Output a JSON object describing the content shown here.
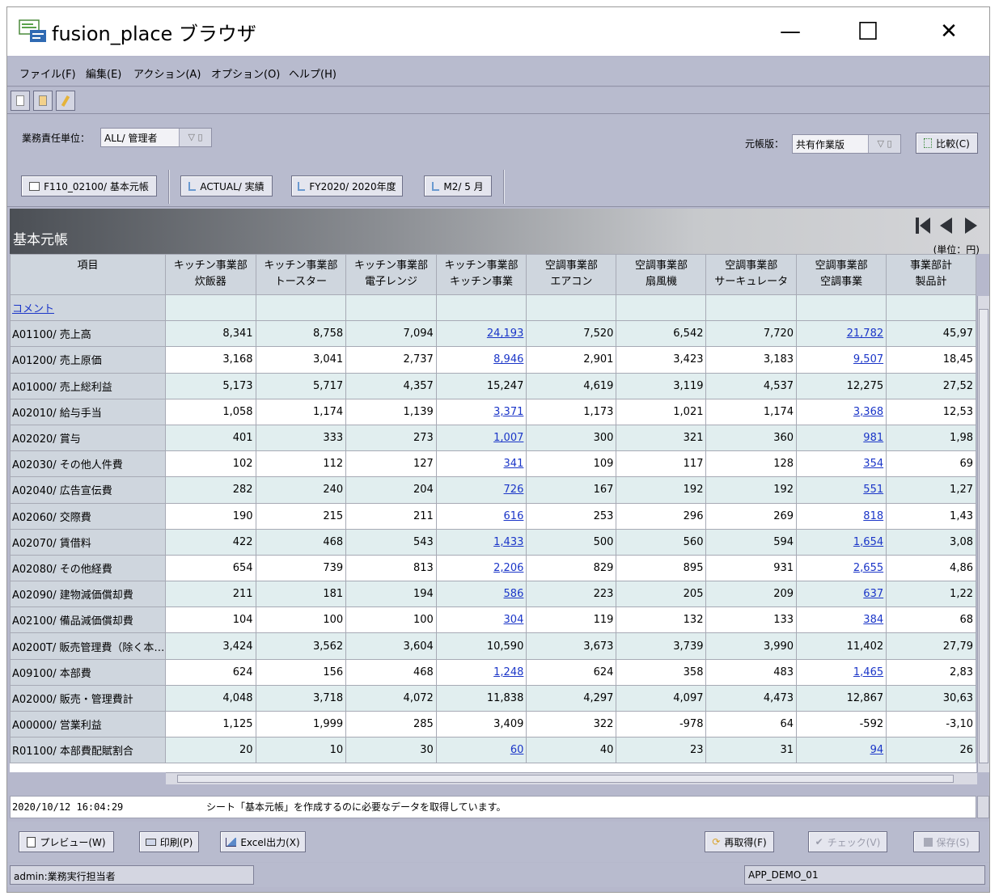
{
  "window": {
    "title": "fusion_place ブラウザ",
    "minimize": "—",
    "maximize": "☐",
    "close": "✕"
  },
  "menu": [
    "ファイル(F)",
    "編集(E)",
    "アクション(A)",
    "オプション(O)",
    "ヘルプ(H)"
  ],
  "pov": {
    "unit_label": "業務責任単位：",
    "unit_value": "ALL/ 管理者",
    "ledger_label": "元帳版：",
    "ledger_value": "共有作業版",
    "compare_button": "比較(C)",
    "filter_glyph": "▽ ▯",
    "dims": [
      "F110_02100/ 基本元帳",
      "ACTUAL/ 実績",
      "FY2020/ 2020年度",
      "M2/ 5 月"
    ]
  },
  "sheet": {
    "title": "基本元帳",
    "unit": "(単位：円)"
  },
  "table": {
    "corner": "項目",
    "columns": [
      {
        "l1": "キッチン事業部",
        "l2": "炊飯器"
      },
      {
        "l1": "キッチン事業部",
        "l2": "トースター"
      },
      {
        "l1": "キッチン事業部",
        "l2": "電子レンジ"
      },
      {
        "l1": "キッチン事業部",
        "l2": "キッチン事業"
      },
      {
        "l1": "空調事業部",
        "l2": "エアコン"
      },
      {
        "l1": "空調事業部",
        "l2": "扇風機"
      },
      {
        "l1": "空調事業部",
        "l2": "サーキュレータ"
      },
      {
        "l1": "空調事業部",
        "l2": "空調事業"
      },
      {
        "l1": "事業部計",
        "l2": "製品計"
      }
    ],
    "comment_label": "コメント",
    "rows": [
      {
        "label": "A01100/ 売上高",
        "values": [
          "8,341",
          "8,758",
          "7,094",
          "24,193",
          "7,520",
          "6,542",
          "7,720",
          "21,782",
          "45,97"
        ]
      },
      {
        "label": "A01200/ 売上原価",
        "values": [
          "3,168",
          "3,041",
          "2,737",
          "8,946",
          "2,901",
          "3,423",
          "3,183",
          "9,507",
          "18,45"
        ]
      },
      {
        "label": "A01000/ 売上総利益",
        "values": [
          "5,173",
          "5,717",
          "4,357",
          "15,247",
          "4,619",
          "3,119",
          "4,537",
          "12,275",
          "27,52"
        ]
      },
      {
        "label": "A02010/ 給与手当",
        "values": [
          "1,058",
          "1,174",
          "1,139",
          "3,371",
          "1,173",
          "1,021",
          "1,174",
          "3,368",
          "12,53"
        ]
      },
      {
        "label": "A02020/ 賞与",
        "values": [
          "401",
          "333",
          "273",
          "1,007",
          "300",
          "321",
          "360",
          "981",
          "1,98"
        ]
      },
      {
        "label": "A02030/ その他人件費",
        "values": [
          "102",
          "112",
          "127",
          "341",
          "109",
          "117",
          "128",
          "354",
          "69"
        ]
      },
      {
        "label": "A02040/ 広告宣伝費",
        "values": [
          "282",
          "240",
          "204",
          "726",
          "167",
          "192",
          "192",
          "551",
          "1,27"
        ]
      },
      {
        "label": "A02060/ 交際費",
        "values": [
          "190",
          "215",
          "211",
          "616",
          "253",
          "296",
          "269",
          "818",
          "1,43"
        ]
      },
      {
        "label": "A02070/ 賃借料",
        "values": [
          "422",
          "468",
          "543",
          "1,433",
          "500",
          "560",
          "594",
          "1,654",
          "3,08"
        ]
      },
      {
        "label": "A02080/ その他経費",
        "values": [
          "654",
          "739",
          "813",
          "2,206",
          "829",
          "895",
          "931",
          "2,655",
          "4,86"
        ]
      },
      {
        "label": "A02090/ 建物減価償却費",
        "values": [
          "211",
          "181",
          "194",
          "586",
          "223",
          "205",
          "209",
          "637",
          "1,22"
        ]
      },
      {
        "label": "A02100/ 備品減価償却費",
        "values": [
          "104",
          "100",
          "100",
          "304",
          "119",
          "132",
          "133",
          "384",
          "68"
        ]
      },
      {
        "label": "A0200T/ 販売管理費（除く本…",
        "values": [
          "3,424",
          "3,562",
          "3,604",
          "10,590",
          "3,673",
          "3,739",
          "3,990",
          "11,402",
          "27,79"
        ]
      },
      {
        "label": "A09100/ 本部費",
        "values": [
          "624",
          "156",
          "468",
          "1,248",
          "624",
          "358",
          "483",
          "1,465",
          "2,83"
        ]
      },
      {
        "label": "A02000/ 販売・管理費計",
        "values": [
          "4,048",
          "3,718",
          "4,072",
          "11,838",
          "4,297",
          "4,097",
          "4,473",
          "12,867",
          "30,63"
        ]
      },
      {
        "label": "A00000/ 営業利益",
        "values": [
          "1,125",
          "1,999",
          "285",
          "3,409",
          "322",
          "-978",
          "64",
          "-592",
          "-3,10"
        ]
      },
      {
        "label": "R01100/ 本部費配賦割合",
        "values": [
          "20",
          "10",
          "30",
          "60",
          "40",
          "23",
          "31",
          "94",
          "26"
        ]
      }
    ],
    "linked_rows": [
      0,
      1,
      3,
      4,
      5,
      6,
      7,
      8,
      9,
      10,
      11,
      13,
      16
    ],
    "tinted_rows": [
      0,
      2,
      4,
      6,
      8,
      10,
      12,
      14,
      16
    ]
  },
  "log": {
    "time": "2020/10/12 16:04:29",
    "message": "シート「基本元帳」を作成するのに必要なデータを取得しています。"
  },
  "buttons": {
    "preview": "プレビュー(W)",
    "print": "印刷(P)",
    "excel": "Excel出力(X)",
    "refresh": "再取得(F)",
    "check": "チェック(V)",
    "save": "保存(S)"
  },
  "status": {
    "user": "admin:業務実行担当者",
    "app": "APP_DEMO_01"
  },
  "colors": {
    "link": "#1a35c8",
    "tint": "#e1eeef",
    "header": "#cfd6de",
    "chrome": "#b8bbce"
  }
}
